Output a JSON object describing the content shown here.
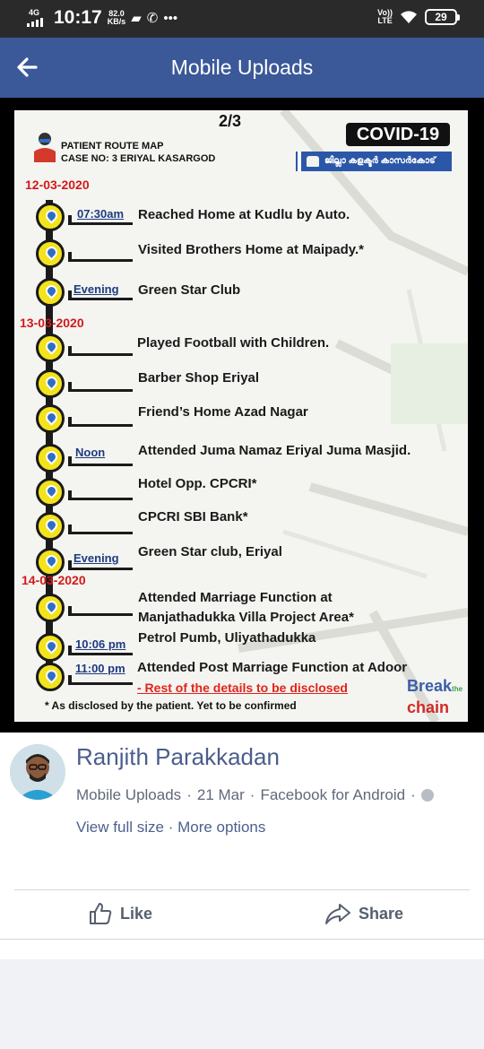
{
  "status_bar": {
    "network": "4G",
    "time": "10:17",
    "speed_value": "82.0",
    "speed_unit": "KB/s",
    "more": "•••",
    "volte_top": "Vo))",
    "volte_bottom": "LTE",
    "battery": "29"
  },
  "app_bar": {
    "title": "Mobile Uploads"
  },
  "poster": {
    "page_indicator": "2/3",
    "route_title": "PATIENT ROUTE MAP",
    "case_line": "CASE NO: 3  ERIYAL KASARGOD",
    "covid_badge": "COVID-19",
    "collector_text": "ജില്ലാ കളക്ടർ കാസർകോട്",
    "dates": [
      "12-03-2020",
      "13-03-2020",
      "14-03-2020"
    ],
    "events": [
      {
        "time": "07:30am",
        "text": "Reached Home at Kudlu by Auto."
      },
      {
        "time": "",
        "text": "Visited Brothers Home at Maipady.*"
      },
      {
        "time": "Evening",
        "text": "Green Star Club"
      },
      {
        "time": "",
        "text": "Played Football with Children."
      },
      {
        "time": "",
        "text": "Barber Shop Eriyal"
      },
      {
        "time": "",
        "text": "Friend’s Home Azad Nagar"
      },
      {
        "time": "Noon",
        "text": "Attended Juma Namaz Eriyal Juma Masjid."
      },
      {
        "time": "",
        "text": "Hotel Opp. CPCRI*"
      },
      {
        "time": "",
        "text": "CPCRI SBI Bank*"
      },
      {
        "time": "Evening",
        "text": "Green Star club, Eriyal"
      },
      {
        "time": "",
        "text": "Attended Marriage Function at"
      },
      {
        "time": "10:06 pm",
        "text": "Petrol Pumb, Uliyathadukka"
      },
      {
        "time": "11:00 pm",
        "text": "Attended Post Marriage Function at Adoor"
      }
    ],
    "event_continuation": "Manjathadukka Villa Project Area*",
    "rest_note": "- Rest of the details to be disclosed",
    "footnote": "* As disclosed by the patient. Yet to be confirmed",
    "break_chain_top": "Break",
    "break_chain_the": "the",
    "break_chain_bottom": "chain"
  },
  "post": {
    "author": "Ranjith Parakkadan",
    "album": "Mobile Uploads",
    "date": "21 Mar",
    "app": "Facebook for Android",
    "view_full_size": "View full size",
    "more_options": "More options",
    "like_label": "Like",
    "share_label": "Share"
  },
  "colors": {
    "facebook_blue": "#3b5998",
    "pin_yellow": "#f2e31c",
    "date_red": "#d11a1a"
  }
}
